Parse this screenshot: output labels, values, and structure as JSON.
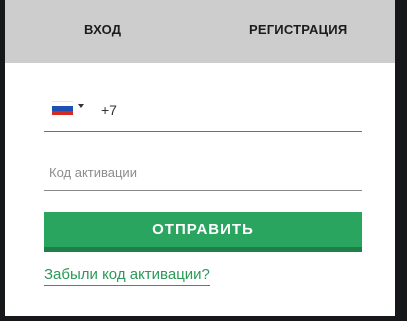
{
  "tabs": {
    "login_label": "ВХОД",
    "register_label": "РЕГИСТРАЦИЯ"
  },
  "phone": {
    "country": "Russia",
    "flag_icon": "russia-flag-icon",
    "value": "+7"
  },
  "activation_code": {
    "value": "",
    "placeholder": "Код активации"
  },
  "submit_label": "ОТПРАВИТЬ",
  "forgot_link": "Забыли код активации?",
  "colors": {
    "accent": "#2aa55f",
    "accent_dark": "#1f7f47",
    "tab_bar": "#cdcdcd",
    "background": "#15171a"
  }
}
